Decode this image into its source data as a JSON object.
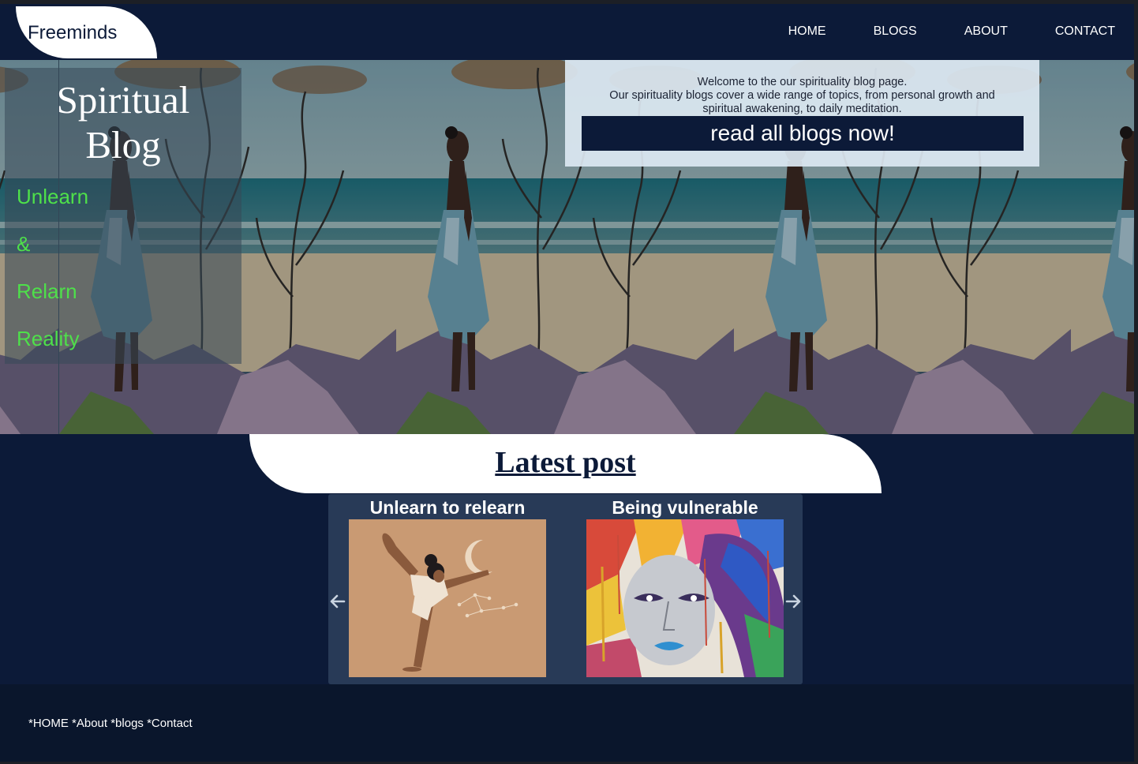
{
  "brand": {
    "logo_text": "Freeminds"
  },
  "nav": {
    "items": [
      {
        "label": "HOME"
      },
      {
        "label": "BLOGS"
      },
      {
        "label": "ABOUT"
      },
      {
        "label": "CONTACT"
      }
    ]
  },
  "hero": {
    "title_line1": "Spiritual",
    "title_line2": "Blog",
    "slogan": [
      "Unlearn",
      "&",
      "Relarn",
      "Reality"
    ],
    "welcome_line1": "Welcome to the our spirituality blog page.",
    "welcome_line2": "Our spirituality blogs cover a wide range of topics, from personal growth and spiritual awakening, to daily meditation.",
    "cta_label": "read all blogs now!",
    "image_icon": "woman-on-beach-painting"
  },
  "latest": {
    "heading": "Latest post",
    "posts": [
      {
        "title": "Unlearn to relearn",
        "image_icon": "yoga-pose-illustration"
      },
      {
        "title": "Being vulnerable",
        "image_icon": "colorful-face-painting"
      }
    ],
    "prev_icon": "arrow-left-icon",
    "next_icon": "arrow-right-icon"
  },
  "footer": {
    "links_text": "*HOME *About *blogs *Contact"
  },
  "colors": {
    "navy": "#0c1a38",
    "slogan_green": "#4ee04a",
    "carousel_bg": "#283a57",
    "welcome_box": "#dce8f2"
  }
}
